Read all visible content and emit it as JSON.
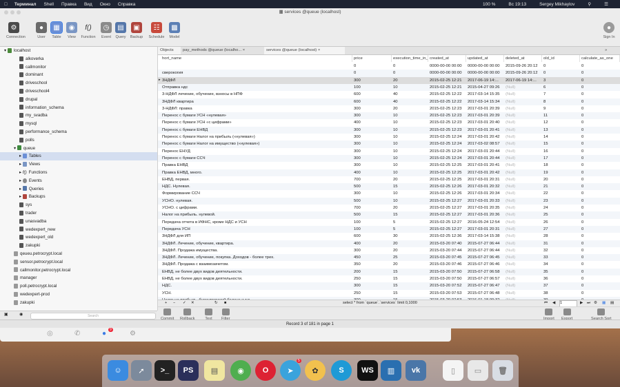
{
  "menubar": {
    "app": "Терминал",
    "items": [
      "Shell",
      "Правка",
      "Вид",
      "Окно",
      "Справка"
    ],
    "battery": "100 %",
    "clock": "Вс 19:13",
    "user": "Sergey Mikhaylov"
  },
  "window": {
    "title": "services @queue (localhost)"
  },
  "toolbar": {
    "buttons": [
      "Connection",
      "User",
      "Table",
      "View",
      "Function",
      "Event",
      "Query",
      "Backup",
      "Schedule",
      "Model"
    ],
    "signin": "Sign In"
  },
  "sidebar": {
    "items": [
      {
        "label": "localhost",
        "indent": 0
      },
      {
        "label": "alkoverka",
        "indent": 1
      },
      {
        "label": "callmonitor",
        "indent": 1
      },
      {
        "label": "dominant",
        "indent": 1
      },
      {
        "label": "driveschool",
        "indent": 1
      },
      {
        "label": "driveschool4",
        "indent": 1
      },
      {
        "label": "drupal",
        "indent": 1
      },
      {
        "label": "information_schema",
        "indent": 1
      },
      {
        "label": "my_svadba",
        "indent": 1
      },
      {
        "label": "mysql",
        "indent": 1
      },
      {
        "label": "performance_schema",
        "indent": 1
      },
      {
        "label": "polls",
        "indent": 1
      },
      {
        "label": "queue",
        "indent": 1
      },
      {
        "label": "Tables",
        "indent": 2
      },
      {
        "label": "Views",
        "indent": 2
      },
      {
        "label": "Functions",
        "indent": 2
      },
      {
        "label": "Events",
        "indent": 2
      },
      {
        "label": "Queries",
        "indent": 2
      },
      {
        "label": "Backups",
        "indent": 2
      },
      {
        "label": "sys",
        "indent": 1
      },
      {
        "label": "trader",
        "indent": 1
      },
      {
        "label": "unasvadba",
        "indent": 1
      },
      {
        "label": "wedexpert_new",
        "indent": 1
      },
      {
        "label": "wedexpert_old",
        "indent": 1
      },
      {
        "label": "zakupki",
        "indent": 1
      },
      {
        "label": "qeueu.petrocrypt.local",
        "indent": 0
      },
      {
        "label": "sensor.petrocrypt.local",
        "indent": 0
      },
      {
        "label": "callmonitor.petrocrypt.local",
        "indent": 0
      },
      {
        "label": "manager",
        "indent": 0
      },
      {
        "label": "poll.petrocrypt.local",
        "indent": 0
      },
      {
        "label": "wedexpert-prod",
        "indent": 0
      },
      {
        "label": "zakupki",
        "indent": 0
      }
    ],
    "search_placeholder": "Search"
  },
  "tabs": [
    "Objects",
    "pay_methods @queue (localho...",
    "services @queue (localhost)"
  ],
  "columns": [
    "hort_name",
    "price",
    "execution_time_in_",
    "created_at",
    "updated_at",
    "deleted_at",
    "old_id",
    "calculate_as_one"
  ],
  "rows": [
    [
      "",
      "0",
      "0",
      "0000-00-00 00:00",
      "0000-00-00 00:00",
      "2015-09-26 20:12",
      "0",
      "0"
    ],
    [
      "сверокогия",
      "0",
      "0",
      "0000-00-00 00:00",
      "0000-00-00 00:00",
      "2015-09-26 20:12",
      "0",
      "0"
    ],
    [
      "3НДФЛ",
      "300",
      "20",
      "2015-02-25 12:21",
      "2017-06-19 14:...",
      "2017-06-19 14:...",
      "3",
      "0"
    ],
    [
      "Отправка ндс",
      "100",
      "10",
      "2015-02-25 12:21",
      "2015-04-27 09:26",
      "(Null)",
      "6",
      "0"
    ],
    [
      "3-НДФЛ лечение, обучение, взносы в НПФ",
      "600",
      "40",
      "2015-02-25 12:22",
      "2017-03-14 15:35",
      "(Null)",
      "7",
      "0"
    ],
    [
      "3НДФЛ квартира",
      "600",
      "40",
      "2015-02-25 12:22",
      "2017-03-14 15:34",
      "(Null)",
      "8",
      "0"
    ],
    [
      "3-НДФЛ: правка",
      "300",
      "20",
      "2015-02-25 12:23",
      "2017-03-01 20:39",
      "(Null)",
      "9",
      "0"
    ],
    [
      "Перенос с бумаги УСН «нулевая»",
      "300",
      "10",
      "2015-02-25 12:23",
      "2017-03-01 20:39",
      "(Null)",
      "11",
      "0"
    ],
    [
      "Перенос с бумаги УСН «с цифрами»",
      "400",
      "10",
      "2015-02-25 12:23",
      "2017-03-01 20:40",
      "(Null)",
      "12",
      "0"
    ],
    [
      "Перенос с бумаги ЕНВД",
      "300",
      "10",
      "2015-02-25 12:23",
      "2017-03-01 20:41",
      "(Null)",
      "13",
      "0"
    ],
    [
      "Перенос с бумаги Налог на прибыль («нулевая»)",
      "300",
      "10",
      "2015-02-25 12:24",
      "2017-03-01 20:42",
      "(Null)",
      "14",
      "0"
    ],
    [
      "Перенос с бумаги Налог на имущество («нулевая»)",
      "300",
      "10",
      "2015-02-25 12:24",
      "2017-03-02 08:57",
      "(Null)",
      "15",
      "0"
    ],
    [
      "Перенос ЕНУД",
      "300",
      "10",
      "2015-02-25 12:24",
      "2017-03-01 20:44",
      "(Null)",
      "16",
      "0"
    ],
    [
      "Перенос с бумаги ССЧ",
      "300",
      "10",
      "2015-02-25 12:24",
      "2017-03-01 20:44",
      "(Null)",
      "17",
      "0"
    ],
    [
      "Правка ЕНВД",
      "300",
      "10",
      "2015-02-25 12:25",
      "2017-03-01 20:41",
      "(Null)",
      "18",
      "0"
    ],
    [
      "Правка ЕНВД, много.",
      "400",
      "10",
      "2015-02-25 12:25",
      "2017-03-01 20:42",
      "(Null)",
      "19",
      "0"
    ],
    [
      "ЕНВД, первая.",
      "700",
      "20",
      "2015-02-25 12:25",
      "2017-03-01 20:31",
      "(Null)",
      "20",
      "0"
    ],
    [
      "НДС. Нулевая.",
      "500",
      "15",
      "2015-02-25 12:26",
      "2017-03-01 20:32",
      "(Null)",
      "21",
      "0"
    ],
    [
      "Формирование ССЧ",
      "300",
      "10",
      "2015-02-25 12:26",
      "2017-03-01 20:34",
      "(Null)",
      "22",
      "0"
    ],
    [
      "УСНО. нулевая.",
      "500",
      "10",
      "2015-02-25 12:27",
      "2017-03-01 20:33",
      "(Null)",
      "23",
      "0"
    ],
    [
      "УСНО. с цифрами.",
      "700",
      "20",
      "2015-02-25 12:27",
      "2017-03-01 20:35",
      "(Null)",
      "24",
      "0"
    ],
    [
      "Налог на прибыль. нулевой.",
      "500",
      "15",
      "2015-02-25 12:27",
      "2017-03-01 20:36",
      "(Null)",
      "25",
      "0"
    ],
    [
      "Передача отчета в ИФНС, кроме НДС и УСН",
      "100",
      "5",
      "2015-02-25 12:27",
      "2016-05-24 12:54",
      "(Null)",
      "26",
      "0"
    ],
    [
      "Передача УСН",
      "100",
      "5",
      "2015-02-25 12:27",
      "2017-03-01 20:31",
      "(Null)",
      "27",
      "0"
    ],
    [
      "3НДФЛ для ИП",
      "600",
      "30",
      "2015-02-25 12:36",
      "2017-03-14 15:38",
      "(Null)",
      "28",
      "0"
    ],
    [
      "3НДФЛ. Лечение, обучение, квартира.",
      "400",
      "20",
      "2015-03-20 07:40",
      "2015-07-27 06:44",
      "(Null)",
      "31",
      "0"
    ],
    [
      "3НДФЛ. Продажа имущества.",
      "300",
      "20",
      "2015-03-20 07:44",
      "2015-07-27 06:44",
      "(Null)",
      "32",
      "0"
    ],
    [
      "3НДФЛ. Лечение, обучение, покупка. Доходов - более трех.",
      "450",
      "25",
      "2015-03-20 07:45",
      "2015-07-27 06:45",
      "(Null)",
      "33",
      "0"
    ],
    [
      "3НДФЛ. Продажа с взаимозачетом.",
      "350",
      "20",
      "2015-03-20 07:46",
      "2015-07-27 06:46",
      "(Null)",
      "34",
      "0"
    ],
    [
      "ЕНВД, не более двух видов деятельности.",
      "200",
      "15",
      "2015-03-20 07:50",
      "2015-07-27 06:58",
      "(Null)",
      "35",
      "0"
    ],
    [
      "ЕНВД, не более двух видов деятельности.",
      "250",
      "15",
      "2015-03-20 07:50",
      "2015-07-27 06:57",
      "(Null)",
      "36",
      "0"
    ],
    [
      "НДС.",
      "300",
      "15",
      "2015-03-20 07:52",
      "2015-07-27 06:47",
      "(Null)",
      "37",
      "0"
    ],
    [
      "УСН.",
      "250",
      "15",
      "2015-03-20 07:53",
      "2015-07-27 06:48",
      "(Null)",
      "38",
      "0"
    ],
    [
      "Налог на прибыль, бухгалтерский баланс и т.п.",
      "300",
      "15",
      "2015-03-20 07:53",
      "2016-01-18 09:32",
      "(Null)",
      "39",
      "0"
    ]
  ],
  "footer": {
    "query": "select * from `queue`.`services`  limit 0,1000",
    "page": "1",
    "buttons": [
      "Commit",
      "Rollback",
      "Text",
      "Filter"
    ],
    "right_buttons": [
      "Import",
      "Export",
      "Search Sort"
    ]
  },
  "status": "Record 3 of 181 in page 1",
  "dock": {
    "badges": [
      "5",
      "9"
    ]
  }
}
